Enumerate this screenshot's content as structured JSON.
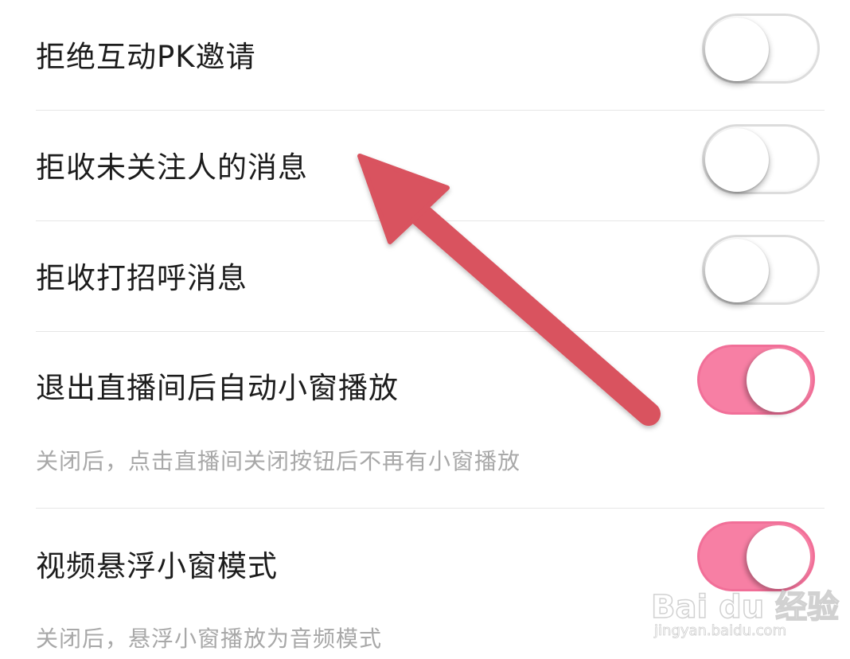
{
  "settings": [
    {
      "label": "拒绝互动PK邀请",
      "on": false
    },
    {
      "label": "拒收未关注人的消息",
      "on": false
    },
    {
      "label": "拒收打招呼消息",
      "on": false
    },
    {
      "label": "退出直播间后自动小窗播放",
      "on": true,
      "description": "关闭后，点击直播间关闭按钮后不再有小窗播放"
    },
    {
      "label": "视频悬浮小窗模式",
      "on": true,
      "description": "关闭后，悬浮小窗播放为音频模式"
    }
  ],
  "colors": {
    "toggle_on": "#f77fa4",
    "toggle_off_border": "#dcdcdc",
    "annotation_arrow": "#d9525f"
  },
  "watermark": {
    "brand": "Bai du 经验",
    "url": "jingyan.baidu.com"
  }
}
